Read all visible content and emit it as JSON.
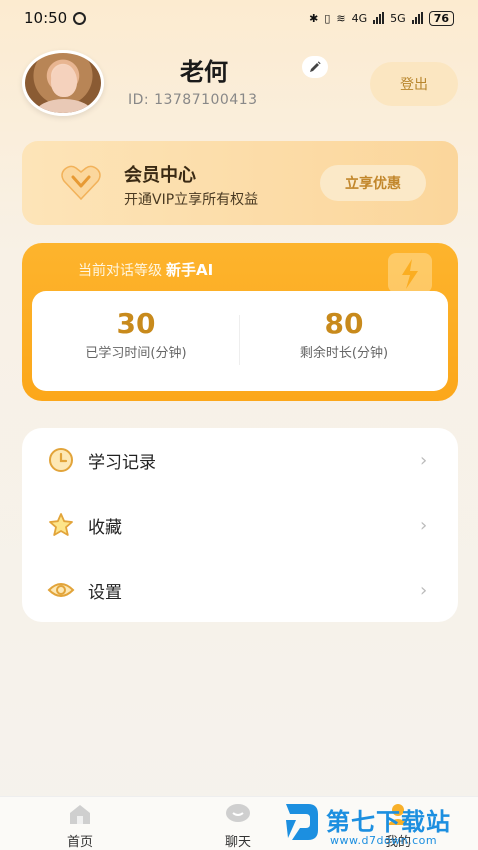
{
  "status_bar": {
    "time": "10:50",
    "battery": "76",
    "net1": "4G",
    "net2": "5G"
  },
  "profile": {
    "name": "老何",
    "id_text": "ID:  13787100413",
    "logout_label": "登出"
  },
  "vip": {
    "title": "会员中心",
    "subtitle": "开通VIP立享所有权益",
    "button": "立享优惠"
  },
  "level": {
    "label": "当前对话等级",
    "value": "新手AI",
    "stats": [
      {
        "number": "30",
        "label": "已学习时间(分钟)"
      },
      {
        "number": "80",
        "label": "剩余时长(分钟)"
      }
    ]
  },
  "menu": {
    "items": [
      {
        "label": "学习记录",
        "icon": "clock-icon"
      },
      {
        "label": "收藏",
        "icon": "star-icon"
      },
      {
        "label": "设置",
        "icon": "eye-settings-icon"
      }
    ]
  },
  "tabs": [
    {
      "label": "首页",
      "icon": "home-icon"
    },
    {
      "label": "聊天",
      "icon": "chat-icon"
    },
    {
      "label": "我的",
      "icon": "profile-icon"
    }
  ],
  "watermark": {
    "title": "第七下载站",
    "url": "www.d7down.com"
  },
  "colors": {
    "accent": "#fca71a",
    "accent_text": "#c88a1c",
    "watermark_blue": "#1c8fe0"
  }
}
